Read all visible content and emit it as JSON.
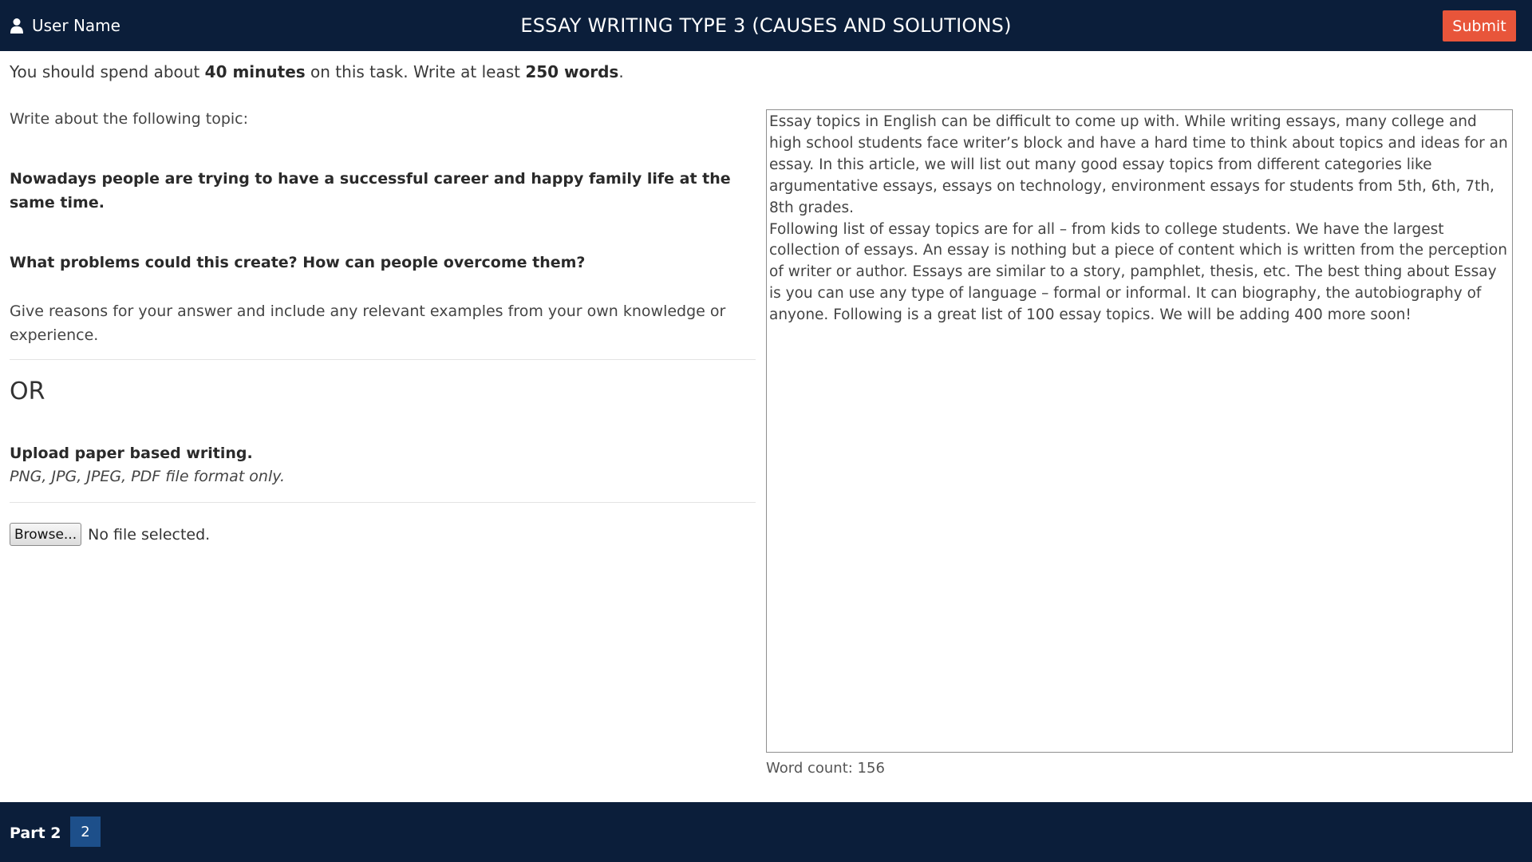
{
  "header": {
    "user_name": "User Name",
    "title": "ESSAY WRITING TYPE 3 (CAUSES AND SOLUTIONS)",
    "submit_label": "Submit"
  },
  "instructions": {
    "part1": "You should spend about ",
    "minutes": "40 minutes",
    "part2": " on this task. Write at least ",
    "words": "250 words",
    "part3": "."
  },
  "task": {
    "intro": "Write about the following topic:",
    "statement": "Nowadays people are trying to have a successful career and happy family life at the same time.",
    "question": "What problems could this create? How can people overcome them?",
    "guidance": "Give reasons for your answer and include any relevant examples from your own knowledge or experience."
  },
  "upload": {
    "or_label": "OR",
    "heading": "Upload paper based writing.",
    "formats": "PNG, JPG, JPEG, PDF file format only.",
    "browse_label": "Browse...",
    "file_status": "No file selected."
  },
  "essay": {
    "text": "Essay topics in English can be difficult to come up with. While writing essays, many college and high school students face writer’s block and have a hard time to think about topics and ideas for an essay. In this article, we will list out many good essay topics from different categories like argumentative essays, essays on technology, environment essays for students from 5th, 6th, 7th, 8th grades.\nFollowing list of essay topics are for all – from kids to college students. We have the largest collection of essays. An essay is nothing but a piece of content which is written from the perception of writer or author. Essays are similar to a story, pamphlet, thesis, etc. The best thing about Essay is you can use any type of language – formal or informal. It can biography, the autobiography of anyone. Following is a great list of 100 essay topics. We will be adding 400 more soon!",
    "word_count_label": "Word count: 156"
  },
  "footer": {
    "part_label": "Part 2",
    "part_button": "2"
  },
  "colors": {
    "bar_background": "#0b1e3a",
    "submit_background": "#e8553a",
    "part_button_background": "#1d4f8a"
  },
  "icons": {
    "user": "user-icon"
  }
}
